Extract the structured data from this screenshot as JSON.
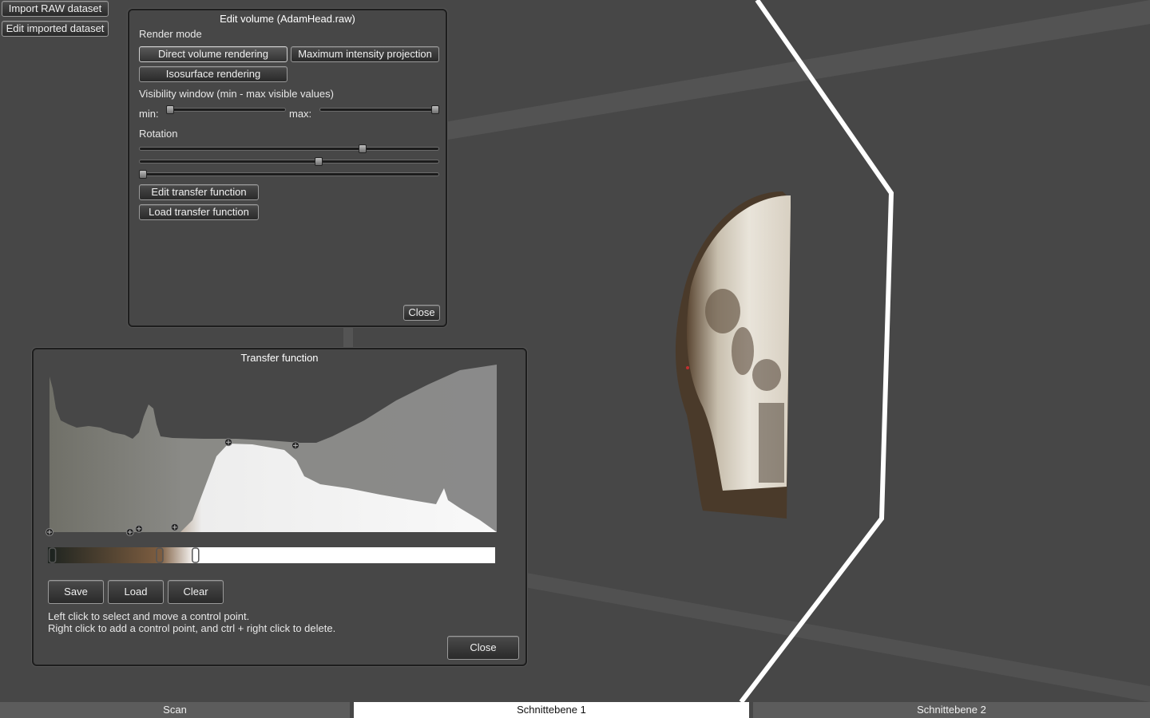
{
  "toolbar": {
    "import_label": "Import RAW dataset",
    "edit_label": "Edit imported dataset"
  },
  "edit_volume": {
    "title": "Edit volume (AdamHead.raw)",
    "render_mode_label": "Render mode",
    "modes": {
      "dvr": "Direct volume rendering",
      "mip": "Maximum intensity projection",
      "iso": "Isosurface rendering"
    },
    "visibility_label": "Visibility window (min - max visible values)",
    "min_label": "min:",
    "max_label": "max:",
    "visibility_min": 0.0,
    "visibility_max": 1.0,
    "rotation_label": "Rotation",
    "rotation_values": [
      0.75,
      0.6,
      0.0
    ],
    "edit_tf_label": "Edit transfer function",
    "load_tf_label": "Load transfer function",
    "close_label": "Close"
  },
  "transfer_function": {
    "title": "Transfer function",
    "save_label": "Save",
    "load_label": "Load",
    "clear_label": "Clear",
    "help_line1": "Left click to select and move a control point.",
    "help_line2": "Right click to add a control point, and ctrl + right click to delete.",
    "close_label": "Close",
    "alpha_points": [
      [
        0.0,
        0.0
      ],
      [
        0.18,
        0.0
      ],
      [
        0.2,
        0.02
      ],
      [
        0.28,
        0.03
      ],
      [
        0.4,
        0.55
      ],
      [
        0.55,
        0.53
      ]
    ],
    "color_points": [
      {
        "pos": 0.01,
        "color": "#1e2420"
      },
      {
        "pos": 0.25,
        "color": "#7d5d40"
      },
      {
        "pos": 0.33,
        "color": "#ffffff"
      }
    ]
  },
  "tabs": {
    "scan": "Scan",
    "plane1": "Schnittebene 1",
    "plane2": "Schnittebene 2",
    "active": "plane1"
  },
  "colors": {
    "background": "#474747",
    "panel_border": "#1e1e1e",
    "active_tab": "#ffffff"
  }
}
